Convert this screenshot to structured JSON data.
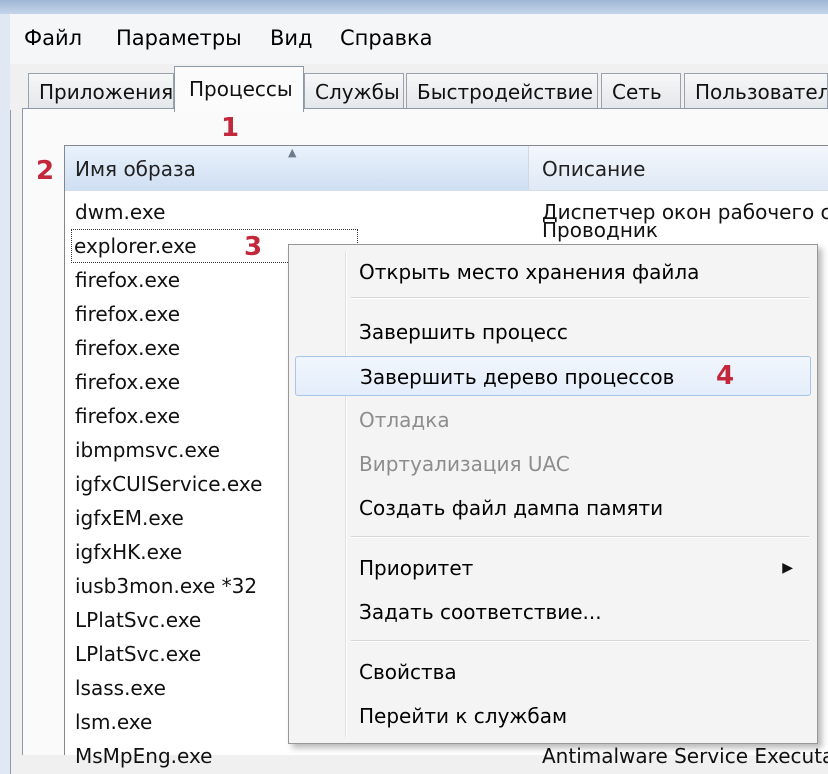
{
  "menu": {
    "items": [
      "Файл",
      "Параметры",
      "Вид",
      "Справка"
    ]
  },
  "tabs": [
    {
      "label": "Приложения"
    },
    {
      "label": "Процессы"
    },
    {
      "label": "Службы"
    },
    {
      "label": "Быстродействие"
    },
    {
      "label": "Сеть"
    },
    {
      "label": "Пользовател"
    }
  ],
  "active_tab": "Процессы",
  "columns": {
    "name": "Имя образа",
    "description": "Описание"
  },
  "processes": [
    {
      "name": "dwm.exe",
      "description": "Диспетчер окон рабочего ст"
    },
    {
      "name": "explorer.exe",
      "description": "Проводник"
    },
    {
      "name": "firefox.exe",
      "description": ""
    },
    {
      "name": "firefox.exe",
      "description": ""
    },
    {
      "name": "firefox.exe",
      "description": ""
    },
    {
      "name": "firefox.exe",
      "description": ""
    },
    {
      "name": "firefox.exe",
      "description": ""
    },
    {
      "name": "ibmpmsvc.exe",
      "description": ""
    },
    {
      "name": "igfxCUIService.exe",
      "description": ""
    },
    {
      "name": "igfxEM.exe",
      "description": ""
    },
    {
      "name": "igfxHK.exe",
      "description": ""
    },
    {
      "name": "iusb3mon.exe *32",
      "description": ""
    },
    {
      "name": "LPlatSvc.exe",
      "description": ""
    },
    {
      "name": "LPlatSvc.exe",
      "description": ""
    },
    {
      "name": "lsass.exe",
      "description": ""
    },
    {
      "name": "lsm.exe",
      "description": ""
    },
    {
      "name": "MsMpEng.exe",
      "description": "Antimalware Service Executab"
    }
  ],
  "selected_process": "explorer.exe",
  "context_menu": {
    "items": [
      {
        "label": "Открыть место хранения файла",
        "enabled": true
      },
      {
        "label": "Завершить процесс",
        "enabled": true
      },
      {
        "label": "Завершить дерево процессов",
        "enabled": true,
        "highlighted": true
      },
      {
        "label": "Отладка",
        "enabled": false
      },
      {
        "label": "Виртуализация UAC",
        "enabled": false
      },
      {
        "label": "Создать файл дампа памяти",
        "enabled": true
      },
      {
        "label": "Приоритет",
        "enabled": true,
        "submenu_arrow": "▶"
      },
      {
        "label": "Задать соответствие...",
        "enabled": true
      },
      {
        "label": "Свойства",
        "enabled": true
      },
      {
        "label": "Перейти к службам",
        "enabled": true
      }
    ]
  },
  "annotations": [
    "1",
    "2",
    "3",
    "4"
  ],
  "colors": {
    "annotation": "#c2273b",
    "highlight_border": "#a8c4e6",
    "disabled_text": "#8d8d8d"
  }
}
